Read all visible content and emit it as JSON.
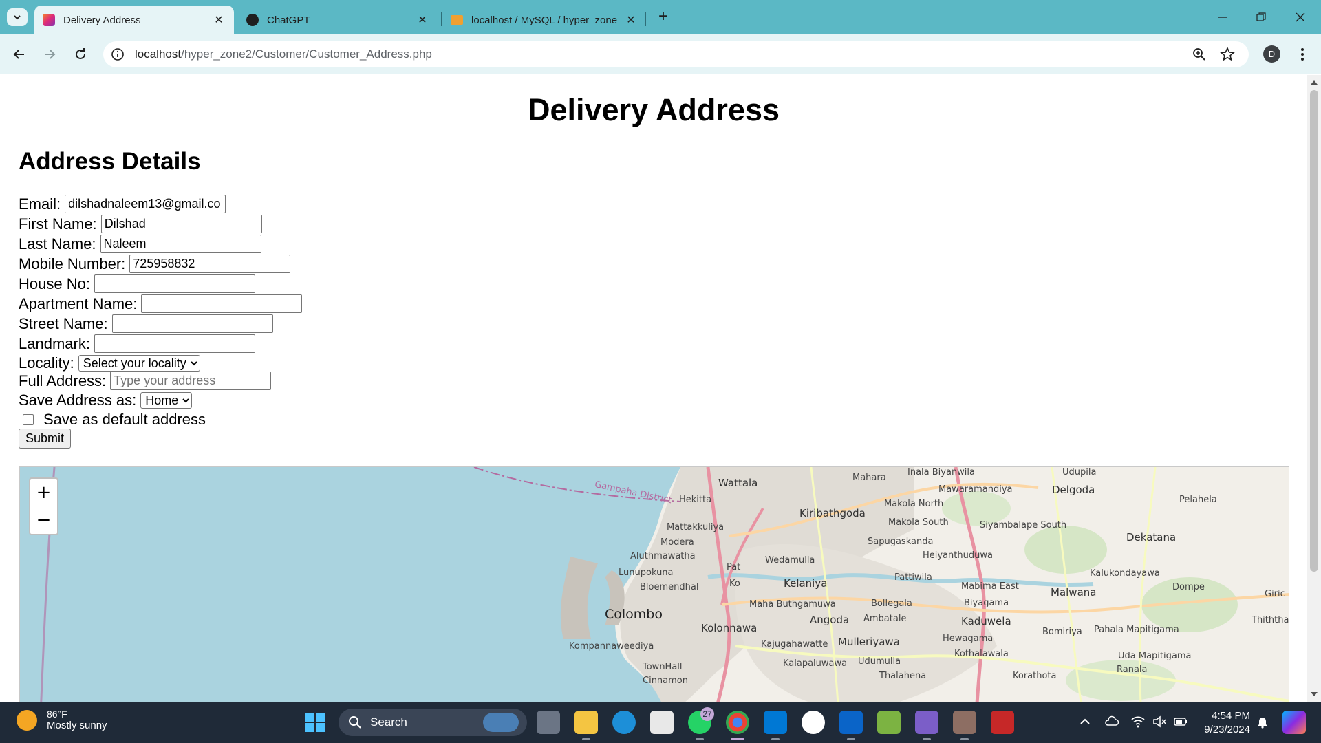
{
  "browser": {
    "tabs": [
      {
        "title": "Delivery Address",
        "active": true,
        "icon": "instagram-like-favicon"
      },
      {
        "title": "ChatGPT",
        "active": false,
        "icon": "chatgpt-favicon"
      },
      {
        "title": "localhost / MySQL / hyper_zone",
        "active": false,
        "icon": "phpmyadmin-favicon"
      }
    ],
    "url_host": "localhost",
    "url_path": "/hyper_zone2/Customer/Customer_Address.php",
    "profile_initial": "D",
    "accent_color": "#5bb8c5"
  },
  "page": {
    "title": "Delivery Address",
    "section_title": "Address Details",
    "form": {
      "email_label": "Email:",
      "email_value": "dilshadnaleem13@gmail.co",
      "first_name_label": "First Name:",
      "first_name_value": "Dilshad",
      "last_name_label": "Last Name:",
      "last_name_value": "Naleem",
      "mobile_label": "Mobile Number:",
      "mobile_value": "725958832",
      "house_label": "House No:",
      "house_value": "",
      "apartment_label": "Apartment Name:",
      "apartment_value": "",
      "street_label": "Street Name:",
      "street_value": "",
      "landmark_label": "Landmark:",
      "landmark_value": "",
      "locality_label": "Locality:",
      "locality_selected": "Select your locality",
      "full_address_label": "Full Address:",
      "full_address_placeholder": "Type your address",
      "save_as_label": "Save Address as:",
      "save_as_selected": "Home",
      "default_label": "Save as default address",
      "default_checked": false,
      "submit_label": "Submit"
    },
    "map": {
      "zoom_in": "+",
      "zoom_out": "−",
      "labels": {
        "gampaha_district": "Gampaha District",
        "hekitta": "Hekitta",
        "wattala": "Wattala",
        "mahara": "Mahara",
        "mawaramandiya": "Mawaramandiya",
        "udupila": "Udupila",
        "delgoda": "Delgoda",
        "pelahela": "Pelahela",
        "kiribathgoda": "Kiribathgoda",
        "makola_north": "Makola North",
        "makola_south": "Makola South",
        "siyambalape_south": "Siyambalape South",
        "dekatana": "Dekatana",
        "mattakkuliya": "Mattakkuliya",
        "modera": "Modera",
        "sapugaskanda": "Sapugaskanda",
        "aluthmawatha": "Aluthmawatha",
        "wedamulla": "Wedamulla",
        "heiyanthuduwa": "Heiyanthuduwa",
        "lunupokuna": "Lunupokuna",
        "pat": "Pat",
        "kalukondayawa": "Kalukondayawa",
        "pattiwila": "Pattiwila",
        "kelaniya": "Kelaniya",
        "ko": "Ko",
        "bloemendhal": "Bloemendhal",
        "mabima_east": "Mabima East",
        "malwana": "Malwana",
        "dompe": "Dompe",
        "biyagama": "Biyagama",
        "maha_buthgamuwa": "Maha Buthgamuwa",
        "bollegala": "Bollegala",
        "colombo": "Colombo",
        "ambatale": "Ambatale",
        "angoda": "Angoda",
        "kaduwela": "Kaduwela",
        "thiththapattara": "Thiththap",
        "kolonnawa": "Kolonnawa",
        "bomiriya": "Bomiriya",
        "pahala_mapitigama": "Pahala Mapitigama",
        "hewagama": "Hewagama",
        "kajugahawatte": "Kajugahawatte",
        "mulleriyawa": "Mulleriyawa",
        "kompannaweediya": "Kompannaweediya",
        "kothalawala": "Kothalawala",
        "uda_mapitigama": "Uda Mapitigama",
        "kalapaluwawa": "Kalapaluwawa",
        "udumulla": "Udumulla",
        "townhall": "TownHall",
        "ranala": "Ranala",
        "thalahena": "Thalahena",
        "korathota": "Korathota",
        "cinnamon": "Cinnamon",
        "giric": "Giric",
        "inala_biyanwila": "Inala Biyanwila"
      }
    }
  },
  "taskbar": {
    "temperature": "86°F",
    "condition": "Mostly sunny",
    "search_label": "Search",
    "whatsapp_badge": "27",
    "time": "4:54 PM",
    "date": "9/23/2024"
  }
}
